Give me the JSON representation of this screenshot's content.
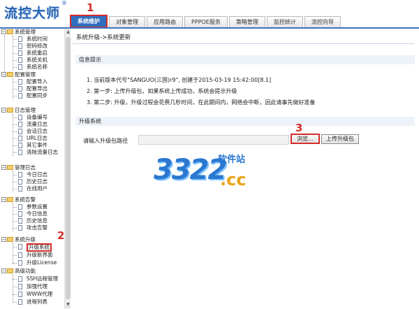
{
  "header": {
    "logo": "流控大师",
    "logo_mark": "®",
    "tabs": [
      "系统维护",
      "对象管理",
      "应用路由",
      "PPPOE服务",
      "策略管理",
      "监控统计",
      "流控向导"
    ]
  },
  "sidebar": {
    "groups": [
      {
        "label": "系统管理",
        "items": [
          "系统时间",
          "密码修改",
          "系统重启",
          "系统关机",
          "系统名称"
        ]
      },
      {
        "label": "配置管理",
        "items": [
          "配置导入",
          "配置导出",
          "配置同步"
        ]
      },
      {
        "label": "日志管理",
        "items": [
          "设备编号",
          "流量日志",
          "会话日志",
          "URL日志",
          "其它事件",
          "清除流量日志"
        ]
      },
      {
        "label": "管理日志",
        "items": [
          "今日日志",
          "历史日志",
          "在线用户"
        ]
      },
      {
        "label": "系统告警",
        "items": [
          "参数设置",
          "今日信息",
          "历史信息",
          "攻击告警"
        ]
      },
      {
        "label": "系统升级",
        "items": [
          "升级系统",
          "升级新界面",
          "升级License"
        ]
      },
      {
        "label": "高级功能",
        "items": [
          "SSH远程管理",
          "加强代理",
          "WWW代理",
          "进程列表"
        ]
      }
    ],
    "toggle_symbol": "−",
    "scroll_up": "▲",
    "scroll_down": "▼"
  },
  "main": {
    "breadcrumb": "系统升级->系统更新",
    "info_title": "信息提示",
    "info_lines": [
      "1. 当前版本代号\"SANGUO(三国)r9\", 创建于2015-03-19 15:42:00[8.1]",
      "2. 第一步: 上传升级包，如果系统上传成功，系统会提示升级",
      "3. 第二步: 升级，升级过程会花费几秒时间，在此期间内，网络会中断，因此请事先做好准备"
    ],
    "upgrade_title": "升级系统",
    "path_label": "请输入升级包路径",
    "browse_label": "浏览...",
    "upload_label": "上传升级包"
  },
  "annotations": {
    "step1": "1",
    "step2": "2",
    "step3": "3"
  },
  "watermark": {
    "number": "3322",
    "site": "软件站",
    "domain": ".cc"
  },
  "colors": {
    "accent": "#2f6dbf",
    "annotation_red": "#d62b2b"
  }
}
